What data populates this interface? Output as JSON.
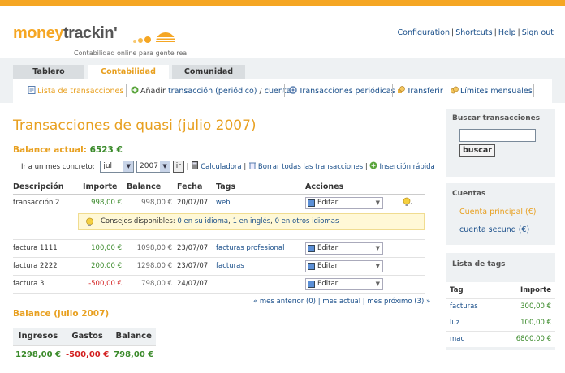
{
  "brand": {
    "money": "money",
    "trackin": "trackin'",
    "tagline": "Contabilidad online para gente real"
  },
  "toplinks": [
    "Configuration",
    "Shortcuts",
    "Help",
    "Sign out"
  ],
  "tabs": [
    {
      "label": "Tablero",
      "active": false
    },
    {
      "label": "Contabilidad",
      "active": true
    },
    {
      "label": "Comunidad",
      "active": false
    }
  ],
  "subnav": {
    "lista": "Lista de transacciones",
    "anadir": "Añadir",
    "transaccion": "transacción (periódico)",
    "slash": "/",
    "cuenta": "cuenta",
    "periodicas": "Transacciones periódicas",
    "transferir": "Transferir",
    "limites": "Límites mensuales"
  },
  "page_title": "Transacciones de quasi (julio 2007)",
  "balance_actual": {
    "label": "Balance actual:",
    "value": "6523 €"
  },
  "monthbar": {
    "label": "Ir a un mes concreto:",
    "month": "jul",
    "year": "2007",
    "go": "ir",
    "calculadora": "Calculadora",
    "borrar": "Borrar todas las transacciones",
    "insercion": "Inserción rápida"
  },
  "table": {
    "headers": [
      "Descripción",
      "Importe",
      "Balance",
      "Fecha",
      "Tags",
      "Acciones"
    ],
    "action_label": "Editar",
    "rows": [
      {
        "desc": "transacción 2",
        "importe": "998,00 €",
        "balance": "998,00 €",
        "fecha": "20/07/07",
        "tags": "web"
      },
      {
        "desc": "factura 1111",
        "importe": "100,00 €",
        "balance": "1098,00 €",
        "fecha": "23/07/07",
        "tags": "facturas profesional"
      },
      {
        "desc": "factura 2222",
        "importe": "200,00 €",
        "balance": "1298,00 €",
        "fecha": "23/07/07",
        "tags": "facturas"
      },
      {
        "desc": "factura 3",
        "importe": "-500,00 €",
        "balance": "798,00 €",
        "fecha": "24/07/07",
        "tags": ""
      }
    ]
  },
  "tip": {
    "label": "Consejos disponibles:",
    "a": "0 en su idioma",
    "b": "1 en inglés",
    "c": "0 en otros idiomas"
  },
  "pager": {
    "prev": "« mes anterior (0)",
    "current": "mes actual",
    "next": "mes próximo (3) »"
  },
  "balance_section": {
    "title": "Balance (julio 2007)",
    "headers": [
      "Ingresos",
      "Gastos",
      "Balance"
    ],
    "values": [
      "1298,00 €",
      "-500,00 €",
      "798,00 €"
    ]
  },
  "sidebar": {
    "search_title": "Buscar transacciones",
    "search_button": "buscar",
    "cuentas_title": "Cuentas",
    "cuentas": [
      "Cuenta principal (€)",
      "cuenta secund (€)"
    ],
    "tags_title": "Lista de tags",
    "tags_headers": [
      "Tag",
      "Importe"
    ],
    "tags": [
      {
        "tag": "facturas",
        "importe": "300,00 €"
      },
      {
        "tag": "luz",
        "importe": "100,00 €"
      },
      {
        "tag": "mac",
        "importe": "6800,00 €"
      }
    ]
  },
  "colors": {
    "accent": "#f5a623",
    "link": "#1a4f8a",
    "positive": "#3a8a2a",
    "negative": "#d32020"
  }
}
